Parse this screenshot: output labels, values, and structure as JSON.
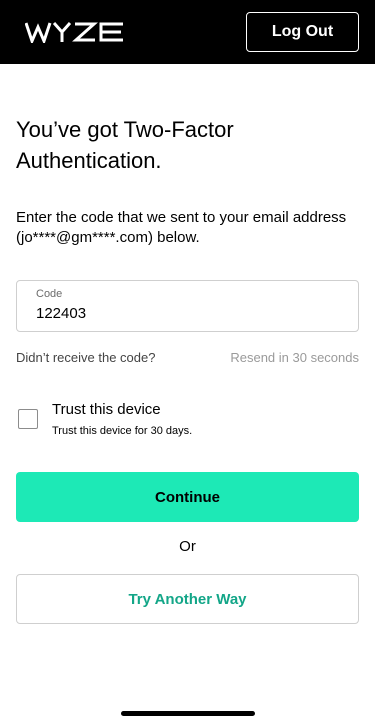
{
  "header": {
    "logo_text": "WYZE",
    "logout_label": "Log Out",
    "background_color": "#000000"
  },
  "main": {
    "title": "You’ve got Two-Factor Authentication.",
    "subtitle": "Enter the code that we sent to your email address (jo****@gm****.com) below.",
    "code_field": {
      "label": "Code",
      "value": "122403"
    },
    "didnt_receive": "Didn’t receive the code?",
    "resend_text": "Resend in 30 seconds",
    "trust_device": {
      "label": "Trust this device",
      "sublabel": "Trust this device for 30 days.",
      "checked": false
    },
    "continue_label": "Continue",
    "or_text": "Or",
    "try_another_label": "Try Another Way"
  },
  "colors": {
    "accent": "#1de9b6",
    "link_accent": "#13a688",
    "muted_text": "#9a9a9a"
  }
}
